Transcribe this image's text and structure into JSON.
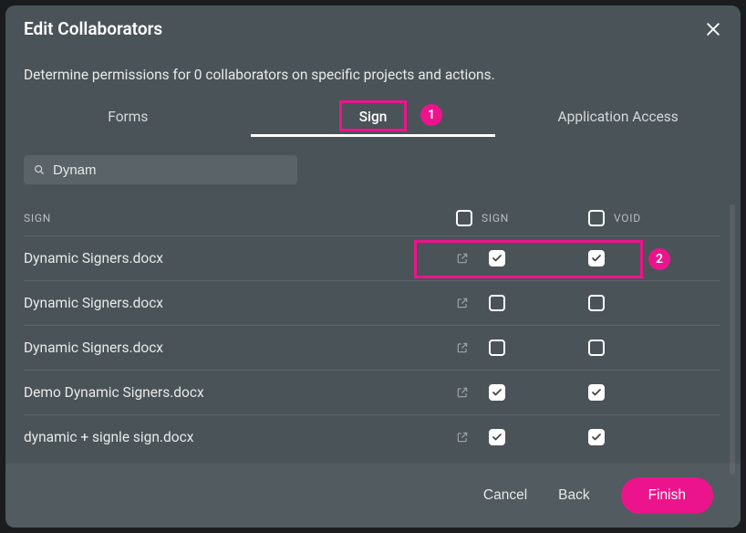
{
  "modal": {
    "title": "Edit  Collaborators",
    "description": "Determine permissions for 0 collaborators on specific projects and actions."
  },
  "tabs": [
    {
      "label": "Forms",
      "active": false
    },
    {
      "label": "Sign",
      "active": true
    },
    {
      "label": "Application Access",
      "active": false
    }
  ],
  "search": {
    "value": "Dynam",
    "placeholder": ""
  },
  "columns": {
    "name": "SIGN",
    "sign": "SIGN",
    "void": "VOID"
  },
  "rows": [
    {
      "name": "Dynamic Signers.docx",
      "sign": true,
      "void": true
    },
    {
      "name": "Dynamic Signers.docx",
      "sign": false,
      "void": false
    },
    {
      "name": "Dynamic Signers.docx",
      "sign": false,
      "void": false
    },
    {
      "name": "Demo Dynamic Signers.docx",
      "sign": true,
      "void": true
    },
    {
      "name": "dynamic + signle sign.docx",
      "sign": true,
      "void": true
    }
  ],
  "footer": {
    "cancel": "Cancel",
    "back": "Back",
    "finish": "Finish"
  },
  "annotations": {
    "marker1": "1",
    "marker2": "2"
  },
  "colors": {
    "accent": "#ec148c"
  }
}
